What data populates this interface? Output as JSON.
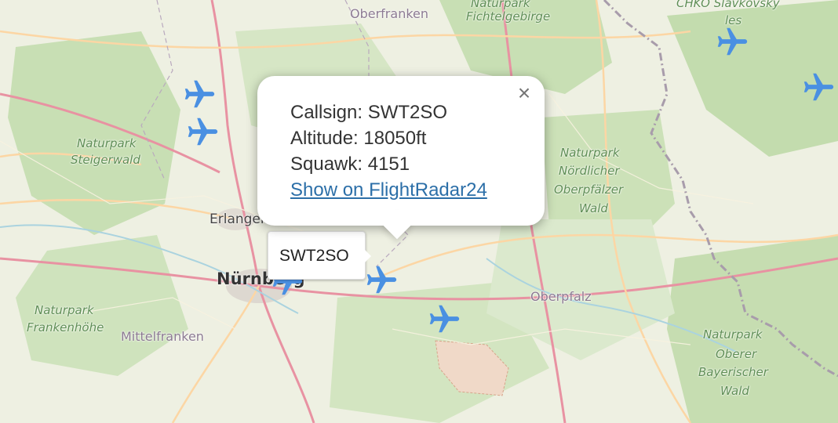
{
  "map": {
    "labels": {
      "oberfranken": "Oberfranken",
      "fichtelgebirge_top": "Naturpark",
      "fichtelgebirge": "Fichtelgebirge",
      "chko1": "CHKO Slavkovský",
      "chko2": "les",
      "steigerwald1": "Naturpark",
      "steigerwald2": "Steigerwald",
      "nordlicher1": "Naturpark",
      "nordlicher2": "Nördlicher",
      "nordlicher3": "Oberpfälzer",
      "nordlicher4": "Wald",
      "erlangen": "Erlangen",
      "nurnberg": "Nürnberg",
      "oberpfalz": "Oberpfalz",
      "frankenhohe1": "Naturpark",
      "frankenhohe2": "Frankenhöhe",
      "mittelfranken": "Mittelfranken",
      "bayerischer1": "Naturpark",
      "bayerischer2": "Oberer",
      "bayerischer3": "Bayerischer",
      "bayerischer4": "Wald"
    },
    "colors": {
      "background": "#f2efe9",
      "forest": "#add19e",
      "road_primary": "#fcd6a4",
      "road_major": "#e892a2",
      "border": "#9e9e9e",
      "plane": "#4a90e2"
    }
  },
  "aircraft": [
    {
      "icon": "airplane-icon"
    },
    {
      "icon": "airplane-icon"
    },
    {
      "icon": "airplane-icon"
    },
    {
      "icon": "airplane-icon"
    },
    {
      "icon": "airplane-icon"
    },
    {
      "icon": "airplane-icon"
    },
    {
      "icon": "airplane-icon"
    }
  ],
  "popup": {
    "callsign": "Callsign: SWT2SO",
    "altitude": "Altitude: 18050ft",
    "squawk": "Squawk: 4151",
    "link": "Show on FlightRadar24",
    "close": "×"
  },
  "tooltip": {
    "label": "SWT2SO"
  }
}
